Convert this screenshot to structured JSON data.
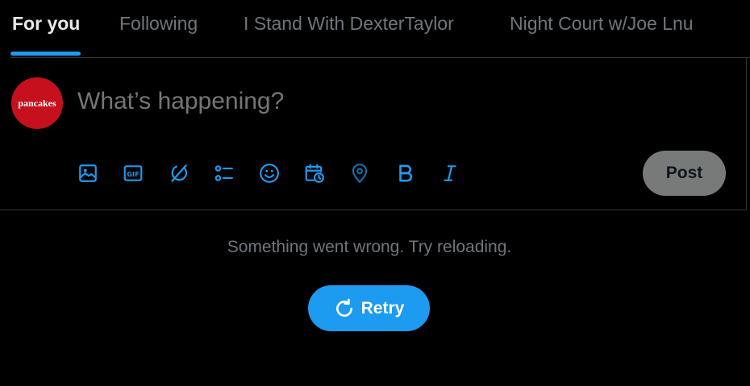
{
  "tabs": [
    {
      "label": "For you",
      "active": true
    },
    {
      "label": "Following",
      "active": false
    },
    {
      "label": "I Stand With DexterTaylor",
      "active": false
    },
    {
      "label": "Night Court w/Joe Lnu",
      "active": false
    }
  ],
  "composer": {
    "avatar_text": "pancakes",
    "placeholder": "What’s happening?",
    "toolbar": [
      "image-icon",
      "gif-icon",
      "grok-icon",
      "poll-icon",
      "emoji-icon",
      "schedule-icon",
      "location-icon",
      "bold-icon",
      "italic-icon"
    ],
    "post_label": "Post"
  },
  "error": {
    "message": "Something went wrong. Try reloading.",
    "retry_label": "Retry"
  },
  "colors": {
    "accent": "#1d9bf0",
    "avatar_bg": "#c6101e",
    "muted_text": "#71767b"
  }
}
